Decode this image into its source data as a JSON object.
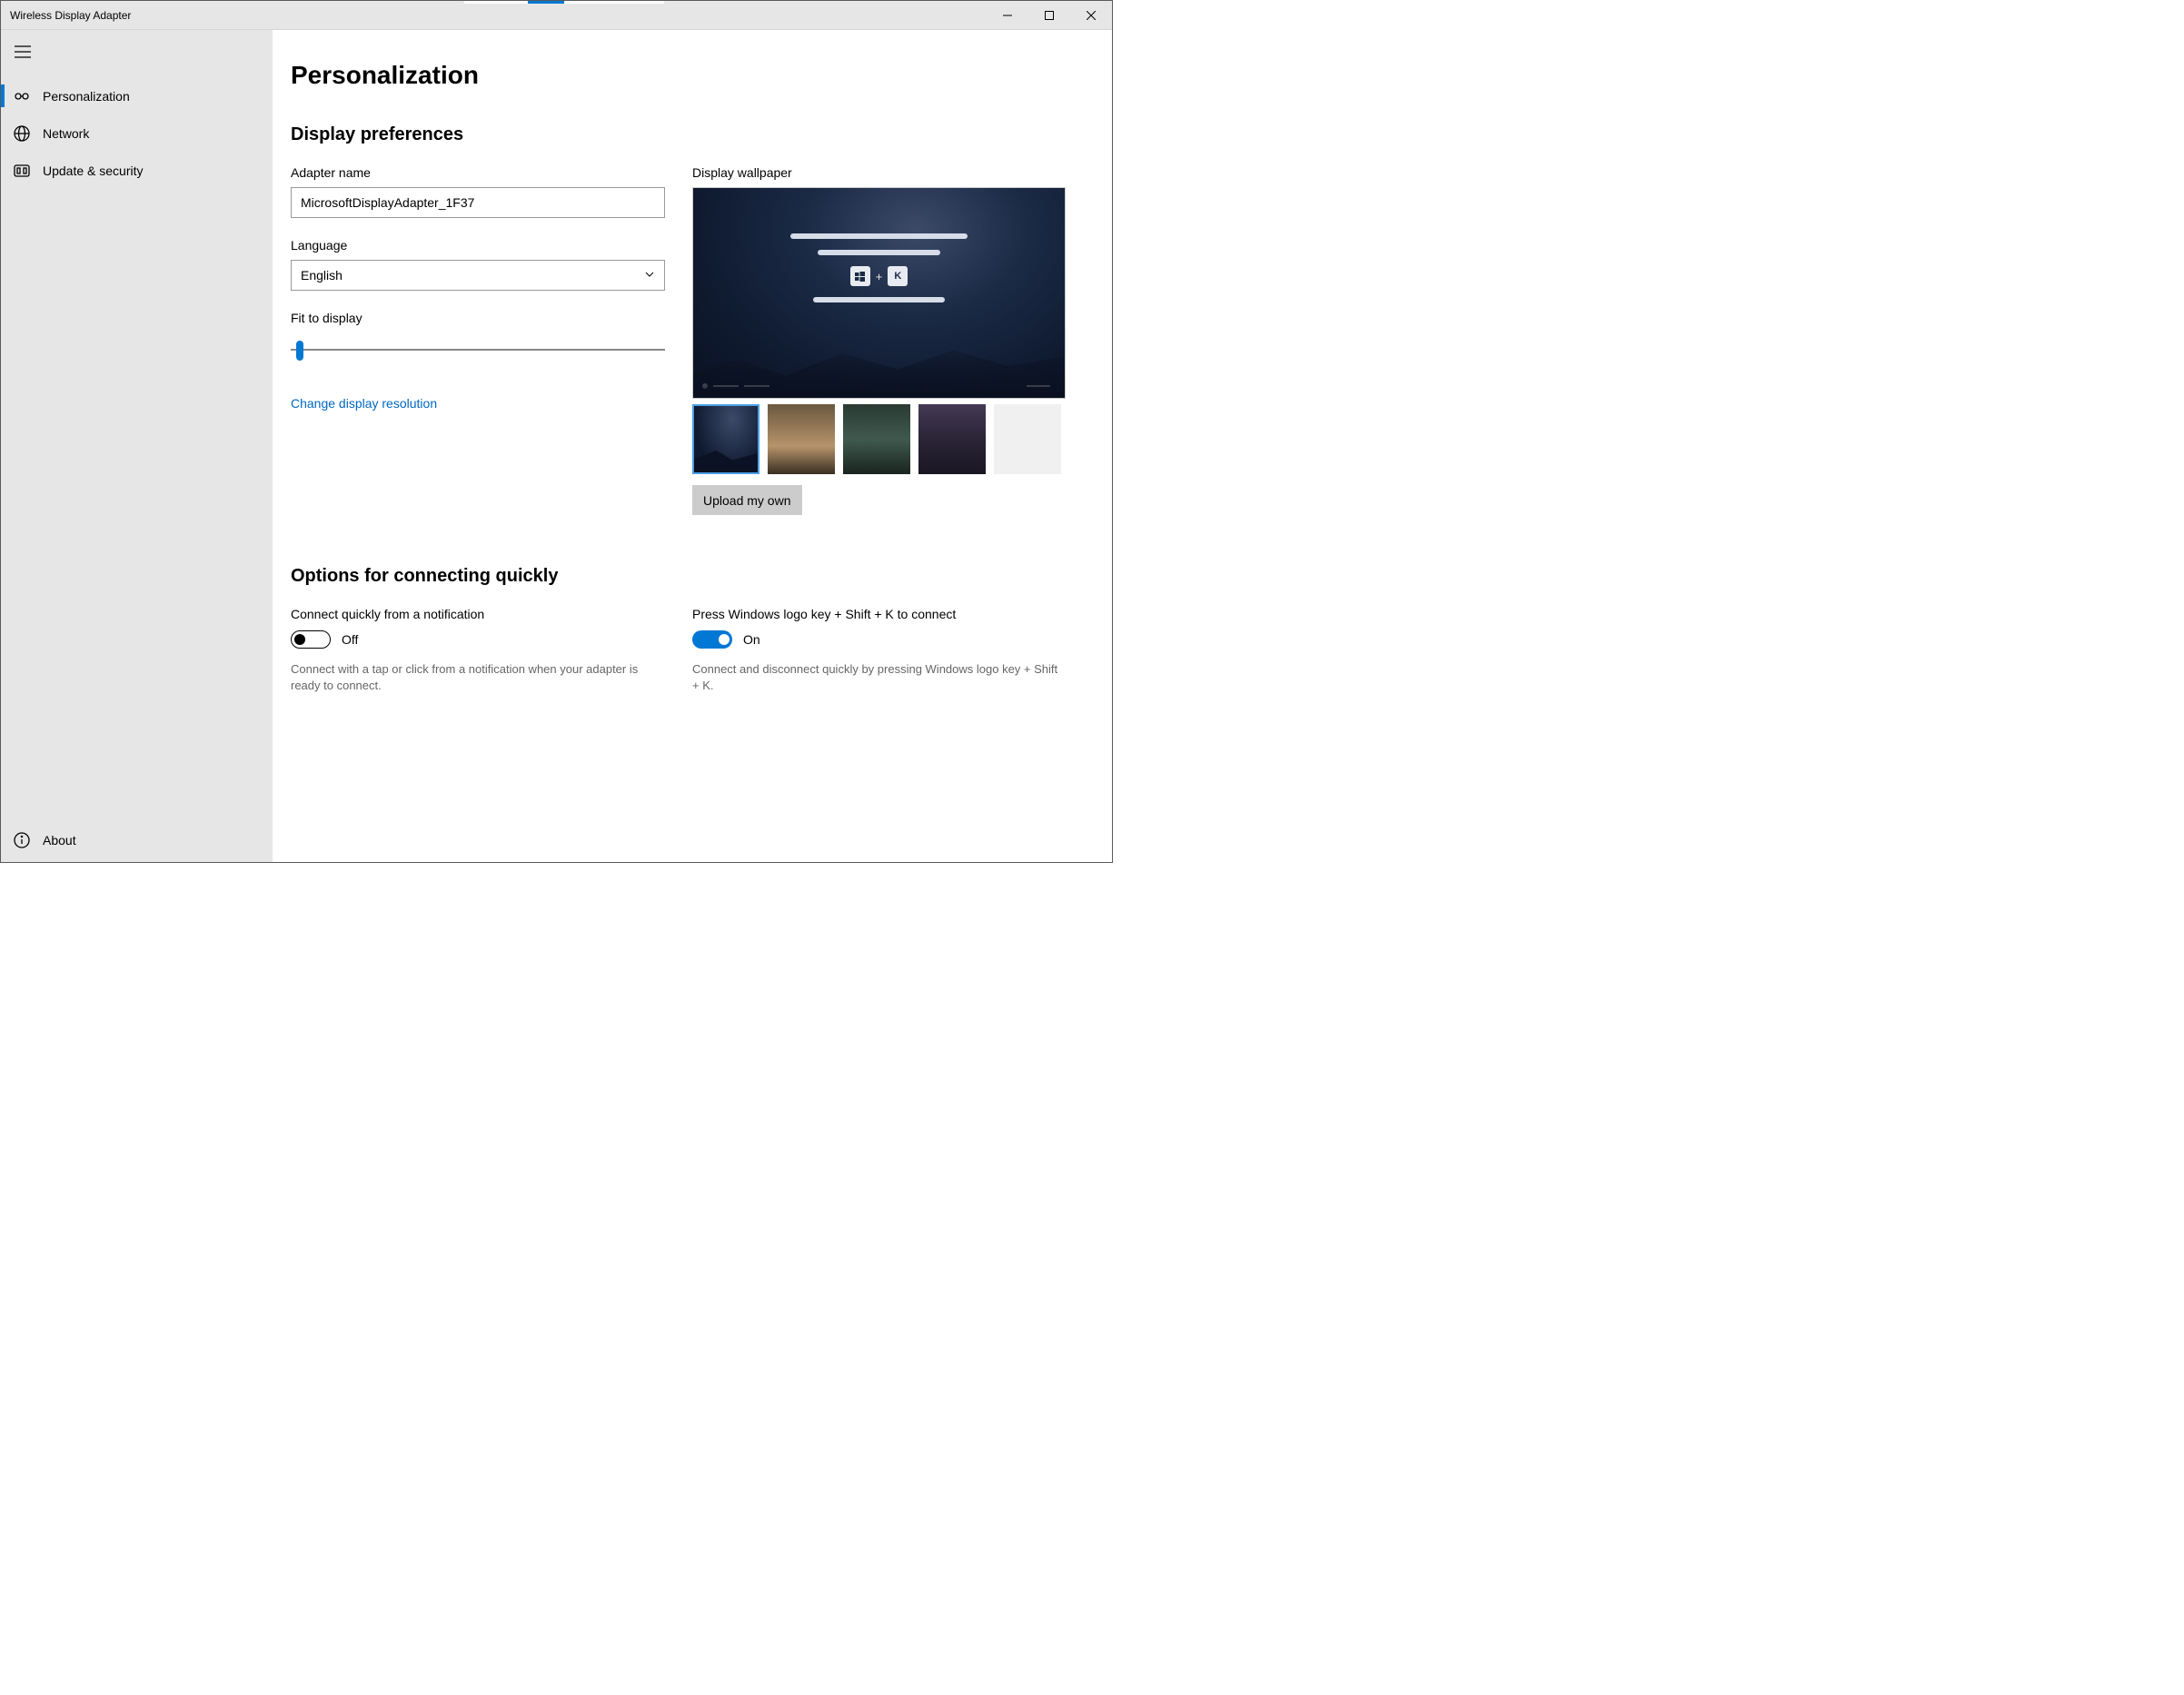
{
  "window": {
    "title": "Wireless Display Adapter"
  },
  "sidebar": {
    "items": [
      {
        "label": "Personalization"
      },
      {
        "label": "Network"
      },
      {
        "label": "Update & security"
      }
    ],
    "about": "About"
  },
  "page": {
    "title": "Personalization",
    "prefs_heading": "Display preferences",
    "adapter_label": "Adapter name",
    "adapter_value": "MicrosoftDisplayAdapter_1F37",
    "language_label": "Language",
    "language_value": "English",
    "fit_label": "Fit to display",
    "resolution_link": "Change display resolution",
    "wallpaper_label": "Display wallpaper",
    "wallpaper_key": "K",
    "upload_label": "Upload my own",
    "options_heading": "Options for connecting quickly",
    "opt1": {
      "label": "Connect quickly from a notification",
      "state": "Off",
      "desc": "Connect with a tap or click from a notification when your adapter is ready to connect."
    },
    "opt2": {
      "label": "Press Windows logo key + Shift + K to connect",
      "state": "On",
      "desc": "Connect and disconnect quickly by pressing Windows logo key + Shift + K."
    }
  }
}
